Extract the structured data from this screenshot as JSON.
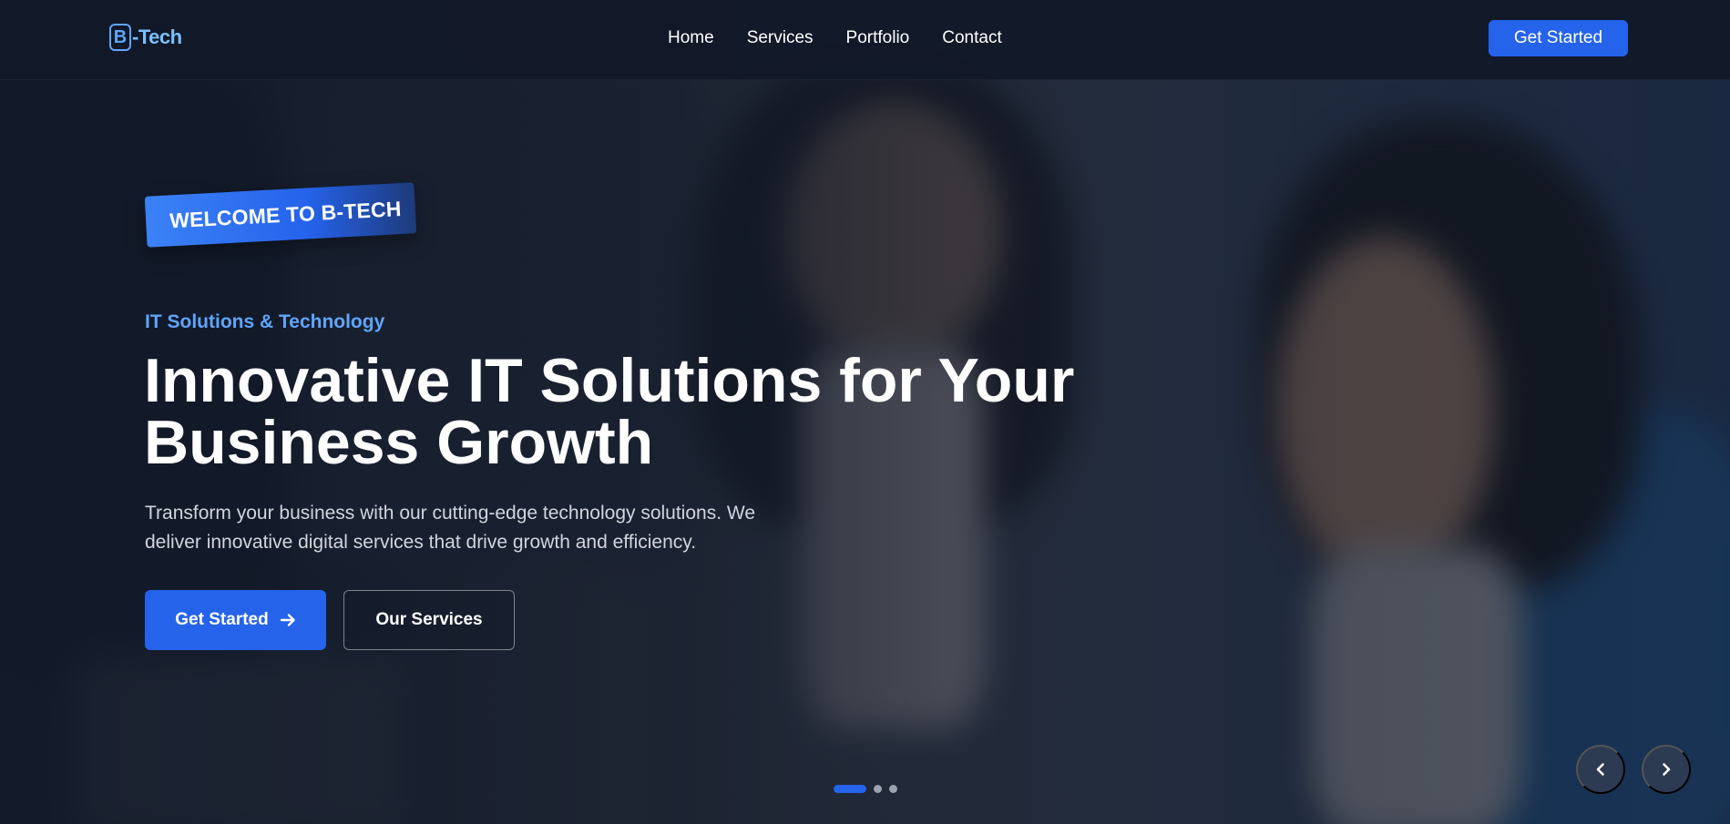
{
  "brand": {
    "logo_letter": "B",
    "logo_text": "-Tech"
  },
  "nav": {
    "links": [
      {
        "label": "Home"
      },
      {
        "label": "Services"
      },
      {
        "label": "Portfolio"
      },
      {
        "label": "Contact"
      }
    ],
    "cta_label": "Get Started"
  },
  "hero": {
    "badge": "WELCOME TO B-TECH",
    "eyebrow": "IT Solutions & Technology",
    "headline_line1": "Innovative IT Solutions for Your",
    "headline_line2": "Business Growth",
    "lede_line1": "Transform your business with our cutting-edge technology solutions. We",
    "lede_line2": "deliver innovative digital services that drive growth and efficiency.",
    "primary_cta": "Get Started",
    "secondary_cta": "Our Services"
  },
  "slider": {
    "slide_count": 3,
    "active_index": 0
  },
  "colors": {
    "accent": "#2563eb",
    "accent_light": "#60a5fa",
    "bg": "#111827"
  },
  "icons": {
    "primary_cta_icon": "arrow-right-icon",
    "prev_icon": "chevron-left-icon",
    "next_icon": "chevron-right-icon"
  }
}
